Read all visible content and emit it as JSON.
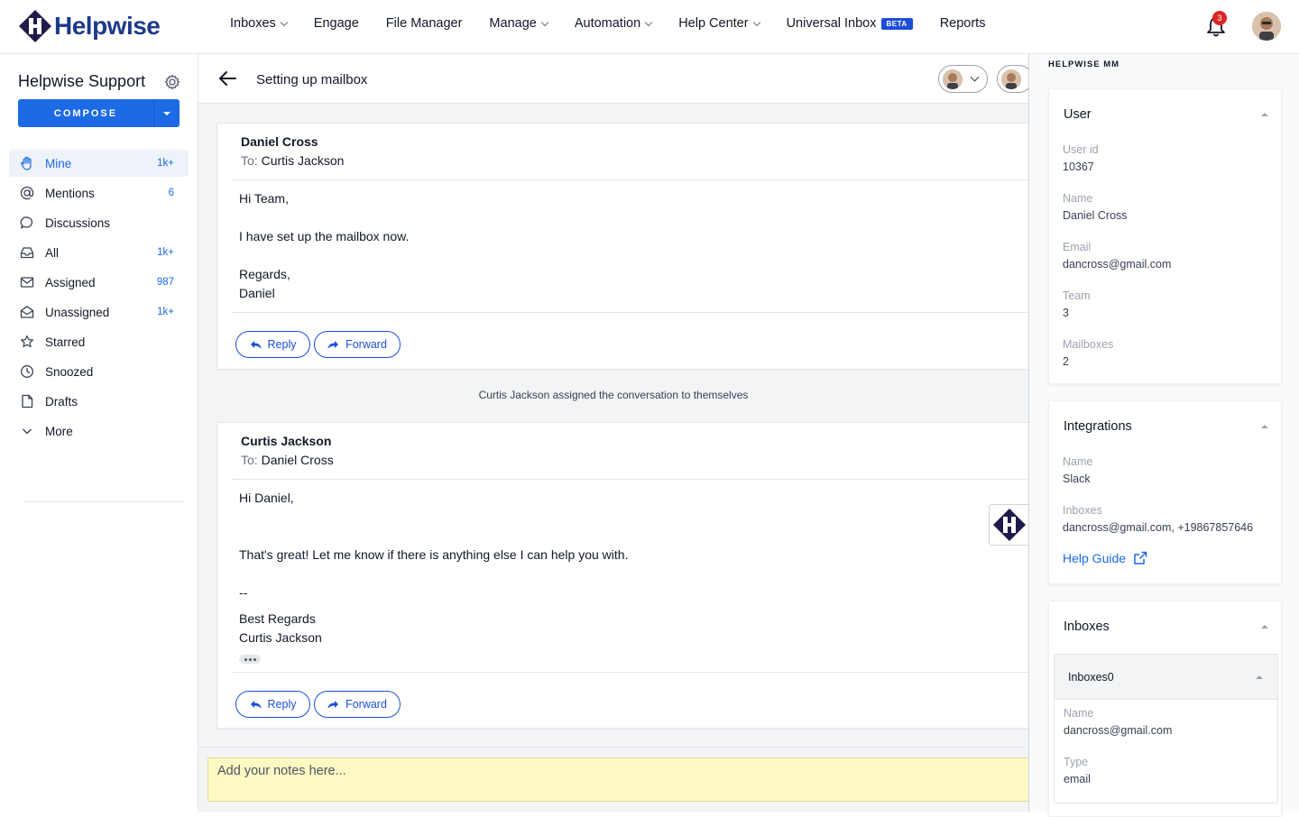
{
  "brand": {
    "name": "Helpwise",
    "color": "#1e3a8a"
  },
  "nav": {
    "items": [
      {
        "label": "Inboxes",
        "dropdown": true
      },
      {
        "label": "Engage",
        "dropdown": false
      },
      {
        "label": "File Manager",
        "dropdown": false
      },
      {
        "label": "Manage",
        "dropdown": true
      },
      {
        "label": "Automation",
        "dropdown": true
      },
      {
        "label": "Help Center",
        "dropdown": true
      },
      {
        "label": "Universal Inbox",
        "dropdown": false,
        "badge": "BETA"
      },
      {
        "label": "Reports",
        "dropdown": false
      }
    ],
    "notifications_count": "3"
  },
  "sidebar": {
    "title": "Helpwise Support",
    "compose_label": "COMPOSE",
    "items": [
      {
        "label": "Mine",
        "count": "1k+",
        "icon": "hand-icon",
        "active": true
      },
      {
        "label": "Mentions",
        "count": "6",
        "icon": "at-icon"
      },
      {
        "label": "Discussions",
        "count": "",
        "icon": "chat-bubble-icon"
      },
      {
        "label": "All",
        "count": "1k+",
        "icon": "inbox-icon"
      },
      {
        "label": "Assigned",
        "count": "987",
        "icon": "envelope-icon"
      },
      {
        "label": "Unassigned",
        "count": "1k+",
        "icon": "open-envelope-icon"
      },
      {
        "label": "Starred",
        "count": "",
        "icon": "star-icon"
      },
      {
        "label": "Snoozed",
        "count": "",
        "icon": "clock-icon"
      },
      {
        "label": "Drafts",
        "count": "",
        "icon": "file-icon"
      },
      {
        "label": "More",
        "count": "",
        "icon": "chevron-down-icon"
      }
    ]
  },
  "conversation": {
    "title": "Setting up mailbox",
    "messages": [
      {
        "from": "Daniel Cross",
        "to_label": "To:",
        "to": "Curtis Jackson",
        "lines": [
          "Hi Team,",
          "I have set up the mailbox now.",
          "Regards,",
          "Daniel"
        ],
        "reply_label": "Reply",
        "forward_label": "Forward"
      },
      {
        "from": "Curtis Jackson",
        "to_label": "To:",
        "to": "Daniel Cross",
        "lines": [
          "Hi Daniel,",
          "That's great! Let me know if there is anything else I can help you with.",
          "--",
          "Best Regards",
          "Curtis Jackson"
        ],
        "reply_label": "Reply",
        "forward_label": "Forward"
      }
    ],
    "activity": "Curtis Jackson assigned the conversation to themselves",
    "notes_placeholder": "Add your notes here..."
  },
  "right_panel": {
    "header": "HELPWISE MM",
    "user": {
      "title": "User",
      "fields": [
        {
          "label": "User id",
          "value": "10367"
        },
        {
          "label": "Name",
          "value": "Daniel Cross"
        },
        {
          "label": "Email",
          "value": "dancross@gmail.com"
        },
        {
          "label": "Team",
          "value": "3"
        },
        {
          "label": "Mailboxes",
          "value": "2"
        }
      ]
    },
    "integrations": {
      "title": "Integrations",
      "fields": [
        {
          "label": "Name",
          "value": "Slack"
        },
        {
          "label": "Inboxes",
          "value": "dancross@gmail.com, +19867857646"
        }
      ],
      "help_guide": "Help Guide"
    },
    "inboxes": {
      "title": "Inboxes",
      "sub_title": "Inboxes0",
      "fields": [
        {
          "label": "Name",
          "value": "dancross@gmail.com"
        },
        {
          "label": "Type",
          "value": "email"
        }
      ]
    }
  },
  "colors": {
    "accent": "#1d6ae5",
    "notes_bg": "#fef9c3",
    "badge": "#dc2626"
  }
}
